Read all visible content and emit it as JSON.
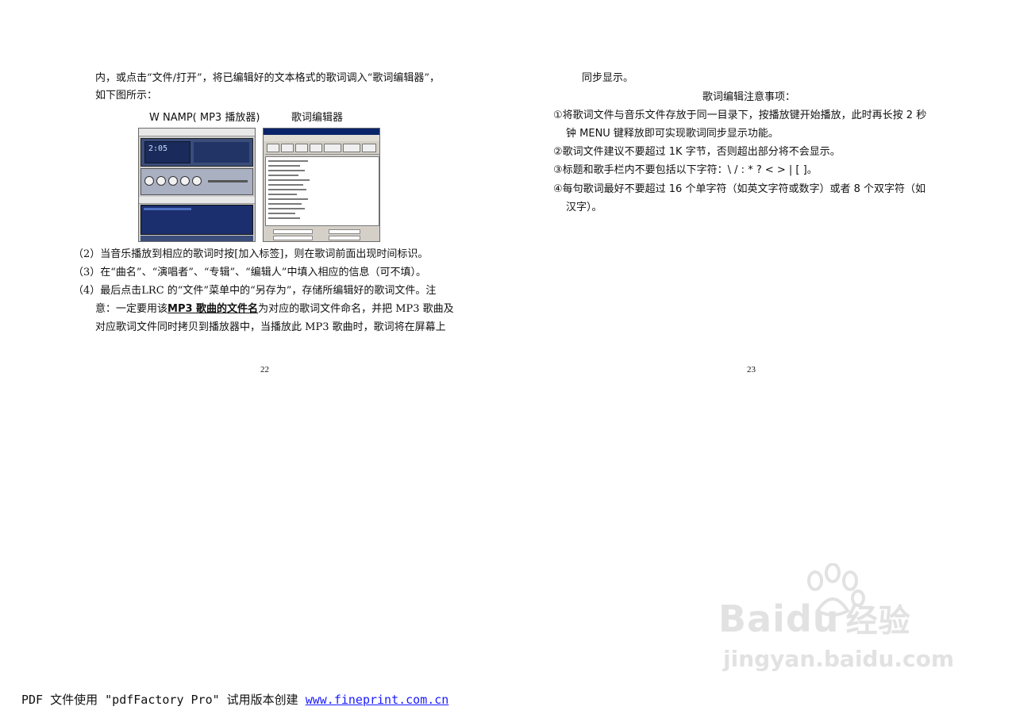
{
  "left_page": {
    "lines": [
      "内，或点击“文件/打开”，将已编辑好的文本格式的歌词调入“歌词编辑器”，",
      "如下图所示："
    ],
    "figure_labels": {
      "winamp": "W NAMP( MP3 播放器)",
      "editor": "歌词编辑器"
    },
    "winamp_time": "2:05",
    "items": [
      "（2）当音乐播放到相应的歌词时按[加入标签]，则在歌词前面出现时间标识。",
      "（3）在“曲名”、“演唱者”、“专辑”、“编辑人”中填入相应的信息（可不填）。",
      "（4）最后点击LRC 的“文件”菜单中的“另存为”，存储所编辑好的歌词文件。注"
    ],
    "item4_line2_pre": "意：一定要用该",
    "item4_line2_emph": "MP3 歌曲的文件名",
    "item4_line2_post": "为对应的歌词文件命名，并把 MP3 歌曲及",
    "item4_line3": "对应歌词文件同时拷贝到播放器中，当播放此 MP3 歌曲时，歌词将在屏幕上",
    "page_number": "22"
  },
  "right_page": {
    "first_line": "同步显示。",
    "heading": "歌词编辑注意事项：",
    "notes": [
      "①将歌词文件与音乐文件存放于同一目录下，按播放键开始播放，此时再长按 2 秒",
      "钟 MENU 键释放即可实现歌词同步显示功能。",
      "②歌词文件建议不要超过 1K 字节，否则超出部分将不会显示。",
      "③标题和歌手栏内不要包括以下字符：\\ / : * ? < > | [ ]。",
      "④每句歌词最好不要超过 16 个单字符（如英文字符或数字）或者 8 个双字符（如",
      "汉字）。"
    ],
    "page_number": "23"
  },
  "watermark": {
    "brand": "Bai",
    "brand2": "du",
    "brand3": "经验",
    "url": "jingyan.baidu.com"
  },
  "footer": {
    "text": "PDF 文件使用 \"pdfFactory Pro\" 试用版本创建 ",
    "link": "www.fineprint.com.cn"
  }
}
